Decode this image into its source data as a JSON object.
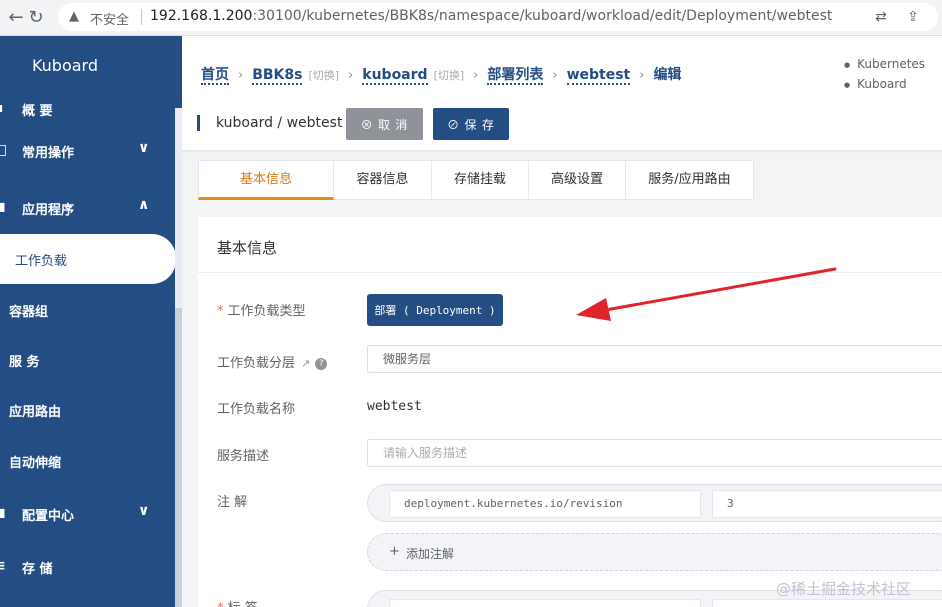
{
  "browser": {
    "insecure_label": "不安全",
    "url_host": "192.168.1.200",
    "url_path": ":30100/kubernetes/BBK8s/namespace/kuboard/workload/edit/Deployment/webtest"
  },
  "sidebar": {
    "logo": "Kuboard",
    "items": [
      {
        "label": "概 要"
      },
      {
        "label": "常用操作",
        "chevron": "∨"
      },
      {
        "label": "应用程序",
        "chevron": "∧"
      },
      {
        "label": "配置中心",
        "chevron": "∨"
      },
      {
        "label": "存 储"
      }
    ],
    "sub_items": [
      {
        "label": "工作负载",
        "active": true
      },
      {
        "label": "容器组"
      },
      {
        "label": "服 务"
      },
      {
        "label": "应用路由"
      },
      {
        "label": "自动伸缩"
      }
    ]
  },
  "breadcrumb": {
    "home": "首页",
    "cluster": "BBK8s",
    "switch1": "[切换]",
    "namespace": "kuboard",
    "switch2": "[切换]",
    "list": "部署列表",
    "resource": "webtest",
    "current": "编辑"
  },
  "versions": [
    "Kubernetes",
    "Kuboard"
  ],
  "header": {
    "title": "kuboard / webtest",
    "cancel_label": "⊗ 取 消",
    "save_label": "⊘ 保 存"
  },
  "tabs": [
    {
      "label": "基本信息",
      "active": true
    },
    {
      "label": "容器信息"
    },
    {
      "label": "存储挂载"
    },
    {
      "label": "高级设置"
    },
    {
      "label": "服务/应用路由"
    }
  ],
  "form": {
    "section_title": "基本信息",
    "workload_type_label": "工作负载类型",
    "workload_type_value": "部署 ( Deployment )",
    "layer_label": "工作负载分层",
    "layer_value": "微服务层",
    "name_label": "工作负载名称",
    "name_value": "webtest",
    "desc_label": "服务描述",
    "desc_placeholder": "请输入服务描述",
    "annotation_label": "注 解",
    "annotation_key": "deployment.kubernetes.io/revision",
    "annotation_value": "3",
    "add_annotation": "添加注解",
    "labels_label": "标 签"
  },
  "watermark": "@稀土掘金技术社区",
  "colors": {
    "primary": "#244d83",
    "accent_tab": "#e58d1d",
    "arrow": "#e0242b"
  }
}
